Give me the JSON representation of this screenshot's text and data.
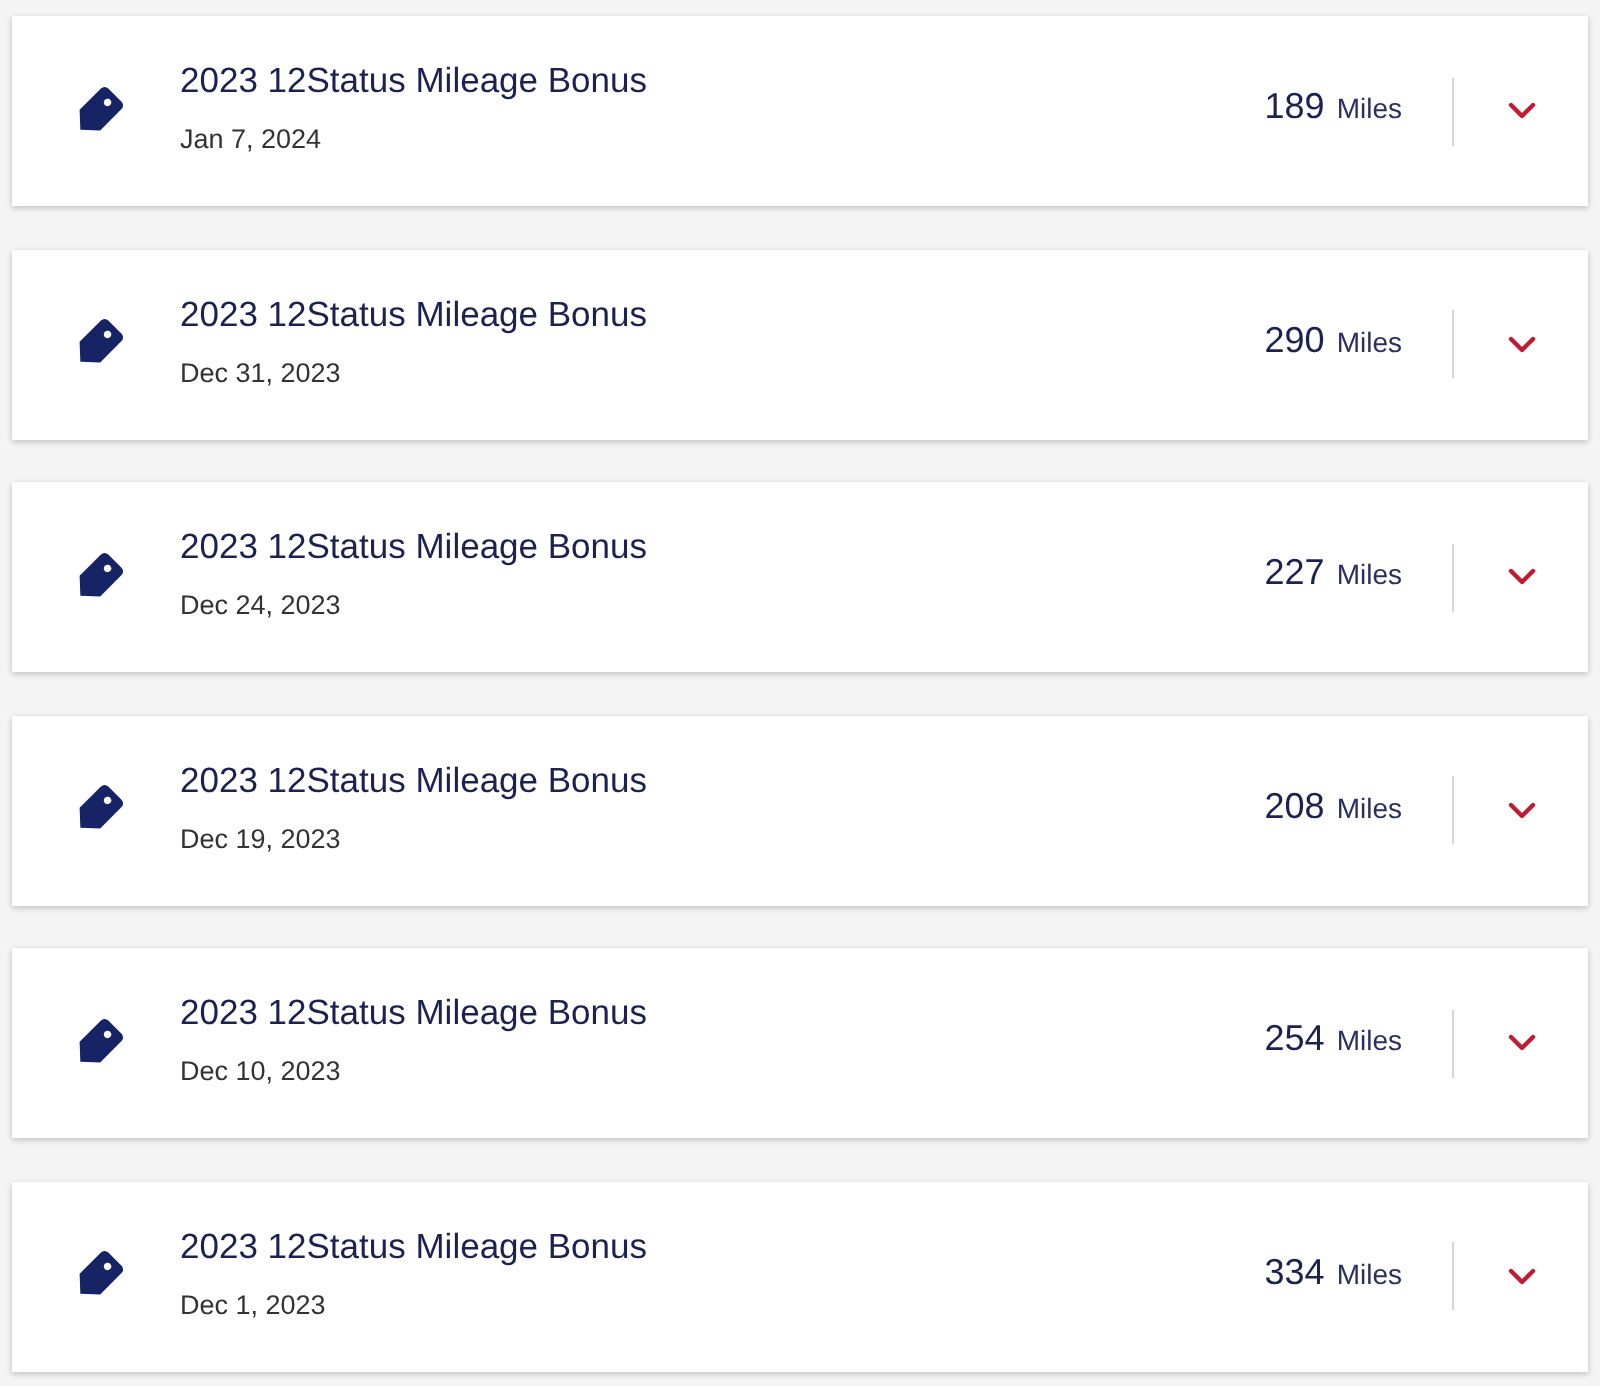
{
  "transactions": [
    {
      "title": "2023 12Status Mileage Bonus",
      "date": "Jan 7, 2024",
      "miles": "189",
      "unit": "Miles",
      "expanded": false
    },
    {
      "title": "2023 12Status Mileage Bonus",
      "date": "Dec 31, 2023",
      "miles": "290",
      "unit": "Miles",
      "expanded": false
    },
    {
      "title": "2023 12Status Mileage Bonus",
      "date": "Dec 24, 2023",
      "miles": "227",
      "unit": "Miles",
      "expanded": false
    },
    {
      "title": "2023 12Status Mileage Bonus",
      "date": "Dec 19, 2023",
      "miles": "208",
      "unit": "Miles",
      "expanded": false
    },
    {
      "title": "2023 12Status Mileage Bonus",
      "date": "Dec 10, 2023",
      "miles": "254",
      "unit": "Miles",
      "expanded": false
    },
    {
      "title": "2023 12Status Mileage Bonus",
      "date": "Dec 1, 2023",
      "miles": "334",
      "unit": "Miles",
      "expanded": false
    }
  ]
}
